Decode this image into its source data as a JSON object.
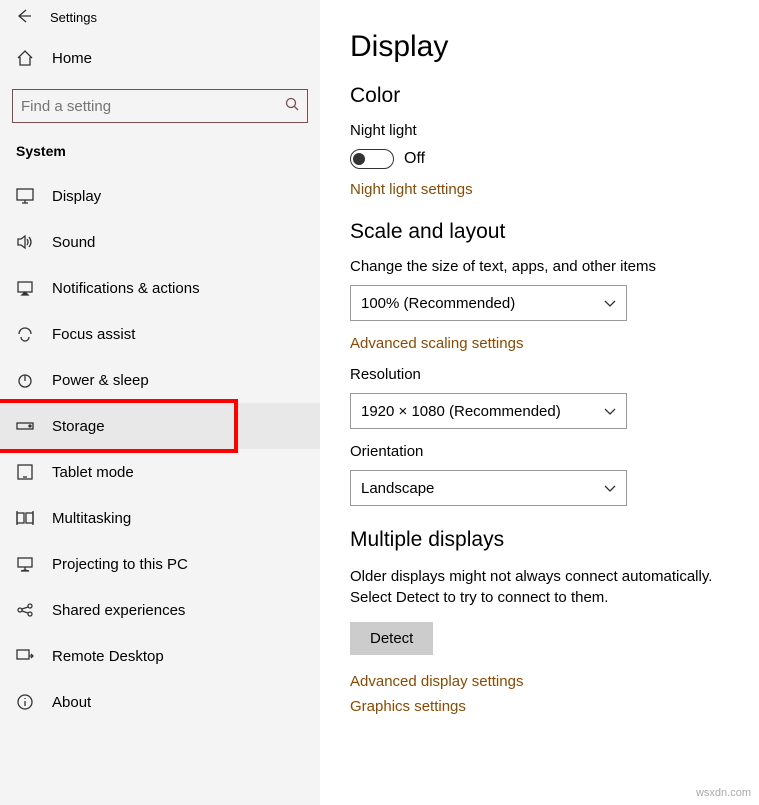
{
  "header": {
    "title": "Settings"
  },
  "sidebar": {
    "home": "Home",
    "search_placeholder": "Find a setting",
    "section": "System",
    "items": [
      {
        "label": "Display"
      },
      {
        "label": "Sound"
      },
      {
        "label": "Notifications & actions"
      },
      {
        "label": "Focus assist"
      },
      {
        "label": "Power & sleep"
      },
      {
        "label": "Storage"
      },
      {
        "label": "Tablet mode"
      },
      {
        "label": "Multitasking"
      },
      {
        "label": "Projecting to this PC"
      },
      {
        "label": "Shared experiences"
      },
      {
        "label": "Remote Desktop"
      },
      {
        "label": "About"
      }
    ]
  },
  "main": {
    "title": "Display",
    "color": {
      "heading": "Color",
      "night_light_label": "Night light",
      "night_light_state": "Off",
      "settings_link": "Night light settings"
    },
    "scale": {
      "heading": "Scale and layout",
      "size_label": "Change the size of text, apps, and other items",
      "size_value": "100% (Recommended)",
      "advanced_link": "Advanced scaling settings",
      "resolution_label": "Resolution",
      "resolution_value": "1920 × 1080 (Recommended)",
      "orientation_label": "Orientation",
      "orientation_value": "Landscape"
    },
    "multiple": {
      "heading": "Multiple displays",
      "desc": "Older displays might not always connect automatically. Select Detect to try to connect to them.",
      "detect": "Detect",
      "advanced_link": "Advanced display settings",
      "graphics_link": "Graphics settings"
    }
  },
  "watermark": "wsxdn.com"
}
